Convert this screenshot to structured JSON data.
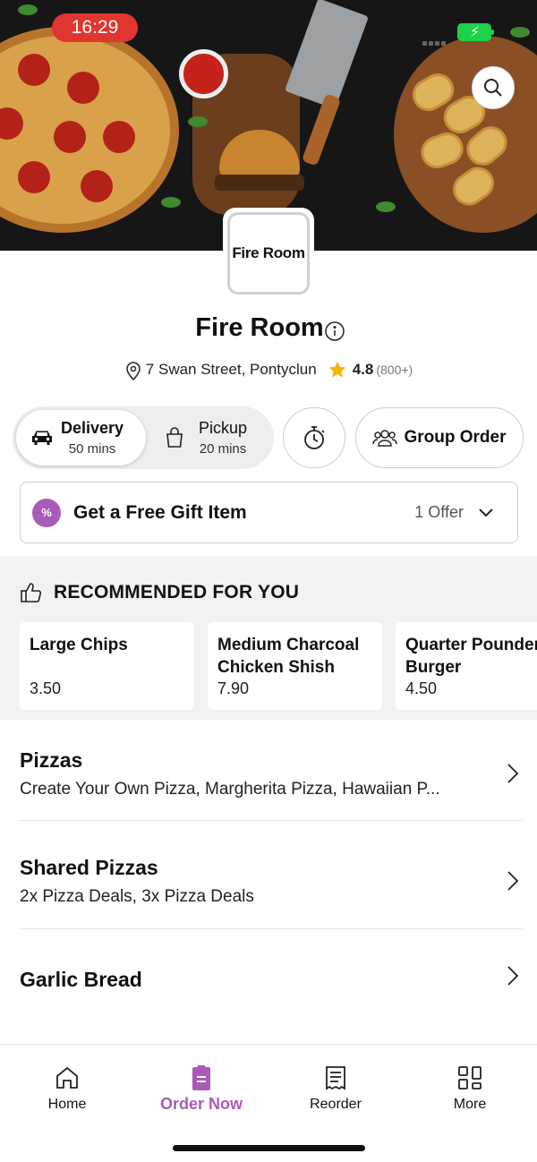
{
  "status_bar": {
    "time": "16:29"
  },
  "header": {
    "search_icon": "search-icon"
  },
  "store": {
    "logo_text": "Fire Room",
    "name": "Fire Room",
    "address": "7 Swan Street, Pontyclun",
    "rating": "4.8",
    "rating_count": "(800+)"
  },
  "order_mode": {
    "delivery": {
      "label": "Delivery",
      "time": "50 mins"
    },
    "pickup": {
      "label": "Pickup",
      "time": "20 mins"
    },
    "group_order_label": "Group Order"
  },
  "offer": {
    "title": "Get a Free Gift Item",
    "count": "1 Offer",
    "badge_symbol": "%"
  },
  "recommended": {
    "heading": "RECOMMENDED FOR YOU",
    "items": [
      {
        "name": "Large Chips",
        "price": "3.50"
      },
      {
        "name": "Medium Charcoal\nChicken Shish",
        "price": "7.90"
      },
      {
        "name": "Quarter Pounder\nBurger",
        "price": "4.50"
      }
    ]
  },
  "categories": [
    {
      "title": "Pizzas",
      "subtitle": "Create Your Own Pizza, Margherita Pizza, Hawaiian P..."
    },
    {
      "title": "Shared Pizzas",
      "subtitle": "2x Pizza Deals, 3x Pizza Deals"
    },
    {
      "title": "Garlic Bread",
      "subtitle": ""
    }
  ],
  "bottom_nav": [
    {
      "label": "Home",
      "icon": "home-icon"
    },
    {
      "label": "Order Now",
      "icon": "order-icon",
      "active": true
    },
    {
      "label": "Reorder",
      "icon": "receipt-icon"
    },
    {
      "label": "More",
      "icon": "grid-icon"
    }
  ],
  "colors": {
    "accent": "#a95bb8",
    "time_pill": "#e0362f",
    "battery": "#1ed14a",
    "star": "#f5b400"
  }
}
